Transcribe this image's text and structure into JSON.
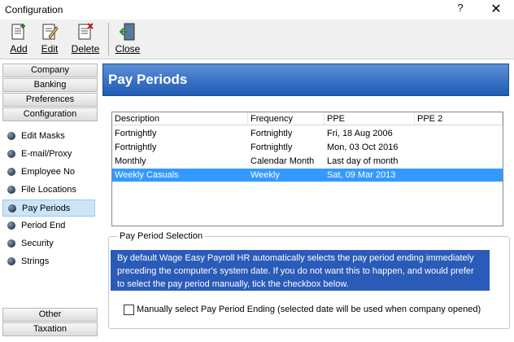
{
  "window": {
    "title": "Configuration",
    "help": "?",
    "close": "✕"
  },
  "toolbar": {
    "add": "Add",
    "edit": "Edit",
    "delete": "Delete",
    "close": "Close"
  },
  "nav": {
    "sections_top": [
      "Company",
      "Banking",
      "Preferences",
      "Configuration"
    ],
    "items": [
      "Edit Masks",
      "E-mail/Proxy",
      "Employee No",
      "File Locations",
      "Pay Periods",
      "Period End",
      "Security",
      "Strings"
    ],
    "selected": "Pay Periods",
    "sections_bottom": [
      "Other",
      "Taxation"
    ]
  },
  "panel": {
    "title": "Pay Periods"
  },
  "grid": {
    "columns": [
      "Description",
      "Frequency",
      "PPE",
      "PPE 2"
    ],
    "rows": [
      [
        "Fortnightly",
        "Fortnightly",
        "Fri, 18 Aug 2006",
        ""
      ],
      [
        "Fortnightly",
        "Fortnightly",
        "Mon, 03 Oct 2016",
        ""
      ],
      [
        "Monthly",
        "Calendar Month",
        "Last day of month",
        ""
      ],
      [
        "Weekly Casuals",
        "Weekly",
        "Sat, 09 Mar 2013",
        ""
      ]
    ],
    "selected_row": 3
  },
  "selection": {
    "label": "Pay Period Selection",
    "note": "By default Wage Easy Payroll HR automatically selects the pay period ending immediately preceding the computer's system date. If you do not want this to happen, and would prefer to select the pay period manually, tick the checkbox below.",
    "checkbox_label": "Manually select Pay Period Ending (selected date will be used when company opened)",
    "checked": false
  },
  "colors": {
    "banner": "#1f5bb4",
    "note_bg": "#2a5bb8",
    "selected_row": "#3399ff"
  }
}
